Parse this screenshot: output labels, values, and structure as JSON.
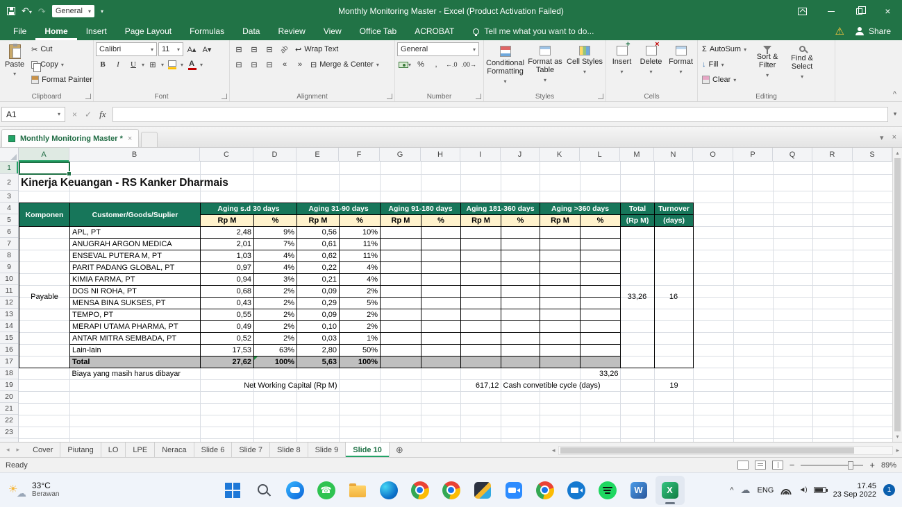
{
  "colors": {
    "excel_green": "#217346",
    "table_header_teal": "#17765A",
    "subheader_yellow": "#FFF2CC",
    "total_row_gray": "#BFBFBF",
    "taskbar_badge_blue": "#0B5FAE"
  },
  "titlebar": {
    "title": "Monthly Monitoring Master - Excel (Product Activation Failed)",
    "qat_style_box": "General"
  },
  "ribbon_tabs": {
    "items": [
      "File",
      "Home",
      "Insert",
      "Page Layout",
      "Formulas",
      "Data",
      "Review",
      "View",
      "Office Tab",
      "ACROBAT"
    ],
    "tell_me": "Tell me what you want to do...",
    "share": "Share"
  },
  "ribbon": {
    "clipboard": {
      "label": "Clipboard",
      "paste": "Paste",
      "cut": "Cut",
      "copy": "Copy",
      "format_painter": "Format Painter"
    },
    "font": {
      "label": "Font",
      "family": "Calibri",
      "size": "11"
    },
    "alignment": {
      "label": "Alignment",
      "wrap_text": "Wrap Text",
      "merge_center": "Merge & Center"
    },
    "number": {
      "label": "Number",
      "format": "General"
    },
    "styles": {
      "label": "Styles",
      "conditional": "Conditional Formatting",
      "format_table": "Format as Table",
      "cell_styles": "Cell Styles"
    },
    "cells": {
      "label": "Cells",
      "insert": "Insert",
      "delete": "Delete",
      "format": "Format"
    },
    "editing": {
      "label": "Editing",
      "autosum": "AutoSum",
      "fill": "Fill",
      "clear": "Clear",
      "sort_filter": "Sort & Filter",
      "find_select": "Find & Select"
    }
  },
  "formula_bar": {
    "name_box": "A1",
    "fx": "fx"
  },
  "officetab": {
    "workbook_tab": "Monthly Monitoring Master *"
  },
  "grid": {
    "columns": [
      "A",
      "B",
      "C",
      "D",
      "E",
      "F",
      "G",
      "H",
      "I",
      "J",
      "K",
      "L",
      "M",
      "N",
      "O",
      "P",
      "Q",
      "R",
      "S"
    ],
    "rows": [
      "1",
      "2",
      "3",
      "4",
      "5",
      "6",
      "7",
      "8",
      "9",
      "10",
      "11",
      "12",
      "13",
      "14",
      "15",
      "16",
      "17",
      "18",
      "19",
      "20",
      "21",
      "22",
      "23"
    ]
  },
  "sheet": {
    "title": "Kinerja Keuangan - RS Kanker Dharmais",
    "header": {
      "komponen": "Komponen",
      "customer": "Customer/Goods/Suplier",
      "aging_1": "Aging s.d 30 days",
      "aging_2": "Aging 31-90 days",
      "aging_3": "Aging 91-180 days",
      "aging_4": "Aging 181-360 days",
      "aging_5": "Aging >360 days",
      "rp": "Rp M",
      "pct": "%",
      "total": "Total",
      "total_sub": "(Rp M)",
      "turnover": "Turnover",
      "turnover_sub": "(days)"
    },
    "komponen_value": "Payable",
    "rows": [
      {
        "name": "APL, PT",
        "c": "2,48",
        "d": "9%",
        "e": "0,56",
        "f": "10%"
      },
      {
        "name": "ANUGRAH ARGON MEDICA",
        "c": "2,01",
        "d": "7%",
        "e": "0,61",
        "f": "11%"
      },
      {
        "name": "ENSEVAL PUTERA M, PT",
        "c": "1,03",
        "d": "4%",
        "e": "0,62",
        "f": "11%"
      },
      {
        "name": "PARIT PADANG GLOBAL, PT",
        "c": "0,97",
        "d": "4%",
        "e": "0,22",
        "f": "4%"
      },
      {
        "name": "KIMIA FARMA, PT",
        "c": "0,94",
        "d": "3%",
        "e": "0,21",
        "f": "4%"
      },
      {
        "name": "DOS NI ROHA, PT",
        "c": "0,68",
        "d": "2%",
        "e": "0,09",
        "f": "2%"
      },
      {
        "name": "MENSA BINA SUKSES, PT",
        "c": "0,43",
        "d": "2%",
        "e": "0,29",
        "f": "5%"
      },
      {
        "name": "TEMPO, PT",
        "c": "0,55",
        "d": "2%",
        "e": "0,09",
        "f": "2%"
      },
      {
        "name": "MERAPI UTAMA PHARMA, PT",
        "c": "0,49",
        "d": "2%",
        "e": "0,10",
        "f": "2%"
      },
      {
        "name": "ANTAR MITRA SEMBADA, PT",
        "c": "0,52",
        "d": "2%",
        "e": "0,03",
        "f": "1%"
      },
      {
        "name": "Lain-lain",
        "c": "17,53",
        "d": "63%",
        "e": "2,80",
        "f": "50%"
      }
    ],
    "total_row": {
      "label": "Total",
      "c": "27,62",
      "d": "100%",
      "e": "5,63",
      "f": "100%"
    },
    "total_value": "33,26",
    "turnover_value": "16",
    "accrued_label": "Biaya yang masih harus dibayar",
    "accrued_value": "33,26",
    "nwc_label": "Net Working Capital (Rp M)",
    "nwc_value": "617,12",
    "ccc_label": "Cash convetible cycle (days)",
    "ccc_value": "19"
  },
  "sheet_tabs": {
    "items": [
      "Cover",
      "Piutang",
      "LO",
      "LPE",
      "Neraca",
      "Slide 6",
      "Slide 7",
      "Slide 8",
      "Slide 9",
      "Slide 10"
    ]
  },
  "status_bar": {
    "ready": "Ready",
    "zoom": "89%"
  },
  "taskbar": {
    "weather_temp": "33°C",
    "weather_desc": "Berawan",
    "word_glyph": "W",
    "excel_glyph": "X",
    "tray_lang": "ENG",
    "time": "17.45",
    "date": "23 Sep 2022",
    "notification_count": "1"
  },
  "icons": {
    "undo": "↶",
    "redo": "↷",
    "dropdown": "▾",
    "cut": "✂",
    "autosum": "Σ",
    "warning": "⚠",
    "check": "✓",
    "close": "×",
    "cloud": "☁",
    "phone": "☎",
    "sun": "☀",
    "plus_tab": "⊕",
    "wrap": "↩",
    "borders": "⊞",
    "merge": "⊟",
    "percent": "%",
    "comma": ",",
    "inc_decimal": "←.0",
    "dec_decimal": ".00→",
    "fill_arrow": "↓",
    "bold": "B",
    "italic": "I",
    "underline": "U",
    "font_color": "A",
    "grow_font": "A▴",
    "shrink_font": "A▾",
    "currency": "$",
    "orientation": "ab",
    "outdent": "«",
    "indent": "»",
    "left_nav": "◂",
    "right_nav": "▸",
    "up": "▴",
    "down": "▾",
    "collapse": "^",
    "speaker": "◄)",
    "minus": "−",
    "plus": "+"
  }
}
